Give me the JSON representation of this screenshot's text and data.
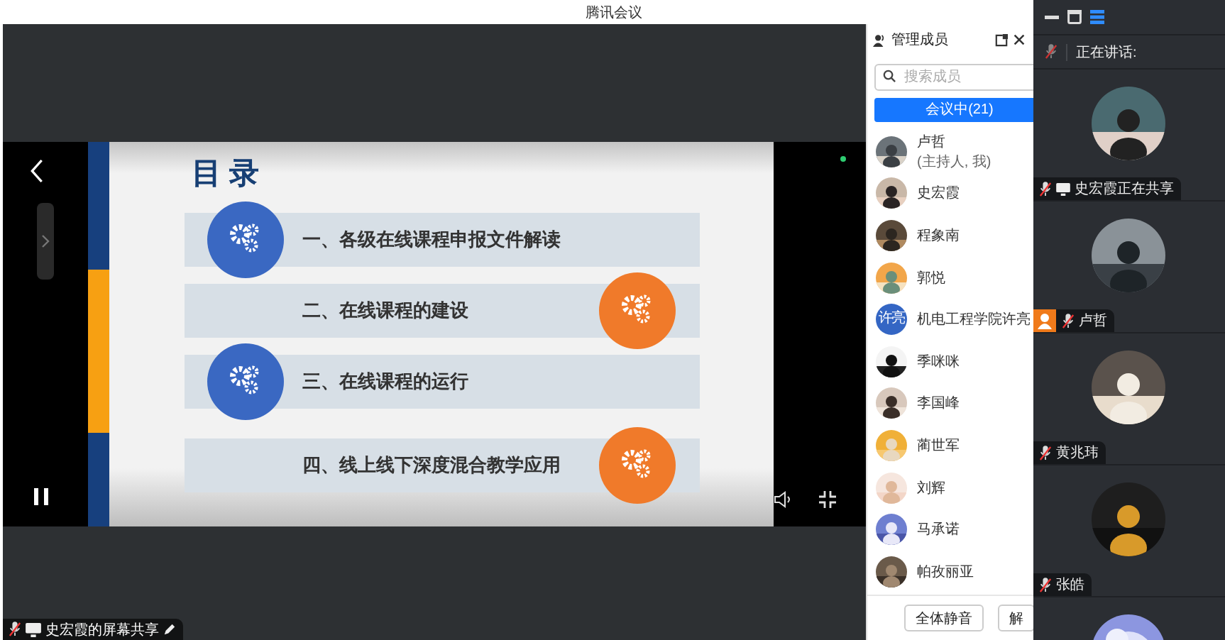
{
  "window": {
    "title": "腾讯会议"
  },
  "shared_screen": {
    "slide": {
      "title": "目 录",
      "items": [
        {
          "text": "一、各级在线课程申报文件解读",
          "color": "#3a68c2",
          "kind": "left"
        },
        {
          "text": "二、在线课程的建设",
          "color": "#f07a2a",
          "kind": "right"
        },
        {
          "text": "三、在线课程的运行",
          "color": "#3a68c2",
          "kind": "left"
        },
        {
          "text": "四、线上线下深度混合教学应用",
          "color": "#f07a2a",
          "kind": "right"
        }
      ]
    },
    "sharer_label": "史宏霞的屏幕共享"
  },
  "members_panel": {
    "title": "管理成员",
    "search": {
      "placeholder": "搜索成员"
    },
    "tab": {
      "label": "会议中(21)",
      "selected": true
    },
    "members": [
      {
        "name": "卢哲",
        "note": "(主持人, 我)"
      },
      {
        "name": "史宏霞"
      },
      {
        "name": "程象南"
      },
      {
        "name": "郭悦"
      },
      {
        "name": "机电工程学院许亮",
        "avatar_text": "许亮"
      },
      {
        "name": "季咪咪"
      },
      {
        "name": "李国峰"
      },
      {
        "name": "蔺世军"
      },
      {
        "name": "刘辉"
      },
      {
        "name": "马承诺"
      },
      {
        "name": "帕孜丽亚"
      }
    ],
    "buttons": [
      "全体静音",
      "解"
    ]
  },
  "speaking": {
    "label": "正在讲话:"
  },
  "tiles": [
    {
      "name": "史宏霞正在共享",
      "muted": true,
      "sharing": true,
      "host": false
    },
    {
      "name": "卢哲",
      "muted": true,
      "sharing": false,
      "host": true
    },
    {
      "name": "黄兆玮",
      "muted": true,
      "sharing": false,
      "host": false
    },
    {
      "name": "张皓",
      "muted": true,
      "sharing": false,
      "host": false
    }
  ]
}
